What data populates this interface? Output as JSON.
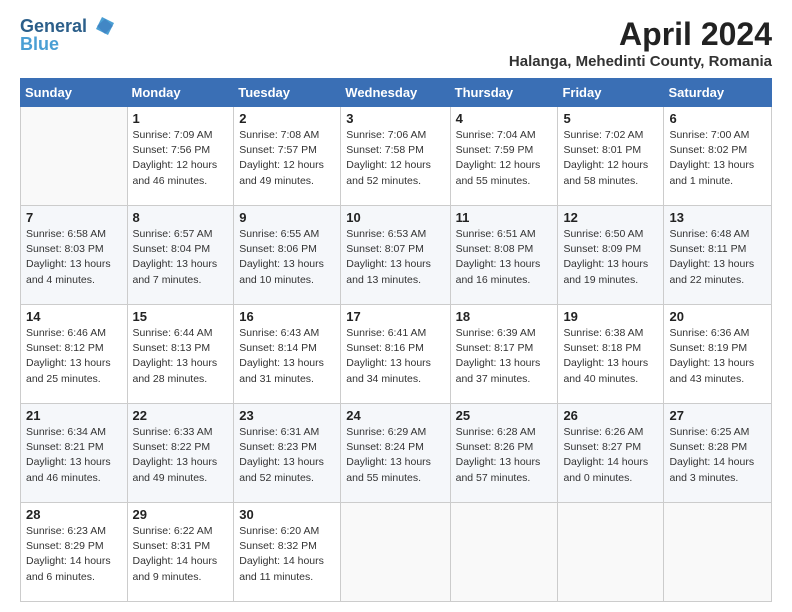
{
  "header": {
    "logo_line1": "General",
    "logo_line2": "Blue",
    "month": "April 2024",
    "location": "Halanga, Mehedinti County, Romania"
  },
  "days_of_week": [
    "Sunday",
    "Monday",
    "Tuesday",
    "Wednesday",
    "Thursday",
    "Friday",
    "Saturday"
  ],
  "weeks": [
    [
      {
        "day": "",
        "info": ""
      },
      {
        "day": "1",
        "info": "Sunrise: 7:09 AM\nSunset: 7:56 PM\nDaylight: 12 hours\nand 46 minutes."
      },
      {
        "day": "2",
        "info": "Sunrise: 7:08 AM\nSunset: 7:57 PM\nDaylight: 12 hours\nand 49 minutes."
      },
      {
        "day": "3",
        "info": "Sunrise: 7:06 AM\nSunset: 7:58 PM\nDaylight: 12 hours\nand 52 minutes."
      },
      {
        "day": "4",
        "info": "Sunrise: 7:04 AM\nSunset: 7:59 PM\nDaylight: 12 hours\nand 55 minutes."
      },
      {
        "day": "5",
        "info": "Sunrise: 7:02 AM\nSunset: 8:01 PM\nDaylight: 12 hours\nand 58 minutes."
      },
      {
        "day": "6",
        "info": "Sunrise: 7:00 AM\nSunset: 8:02 PM\nDaylight: 13 hours\nand 1 minute."
      }
    ],
    [
      {
        "day": "7",
        "info": "Sunrise: 6:58 AM\nSunset: 8:03 PM\nDaylight: 13 hours\nand 4 minutes."
      },
      {
        "day": "8",
        "info": "Sunrise: 6:57 AM\nSunset: 8:04 PM\nDaylight: 13 hours\nand 7 minutes."
      },
      {
        "day": "9",
        "info": "Sunrise: 6:55 AM\nSunset: 8:06 PM\nDaylight: 13 hours\nand 10 minutes."
      },
      {
        "day": "10",
        "info": "Sunrise: 6:53 AM\nSunset: 8:07 PM\nDaylight: 13 hours\nand 13 minutes."
      },
      {
        "day": "11",
        "info": "Sunrise: 6:51 AM\nSunset: 8:08 PM\nDaylight: 13 hours\nand 16 minutes."
      },
      {
        "day": "12",
        "info": "Sunrise: 6:50 AM\nSunset: 8:09 PM\nDaylight: 13 hours\nand 19 minutes."
      },
      {
        "day": "13",
        "info": "Sunrise: 6:48 AM\nSunset: 8:11 PM\nDaylight: 13 hours\nand 22 minutes."
      }
    ],
    [
      {
        "day": "14",
        "info": "Sunrise: 6:46 AM\nSunset: 8:12 PM\nDaylight: 13 hours\nand 25 minutes."
      },
      {
        "day": "15",
        "info": "Sunrise: 6:44 AM\nSunset: 8:13 PM\nDaylight: 13 hours\nand 28 minutes."
      },
      {
        "day": "16",
        "info": "Sunrise: 6:43 AM\nSunset: 8:14 PM\nDaylight: 13 hours\nand 31 minutes."
      },
      {
        "day": "17",
        "info": "Sunrise: 6:41 AM\nSunset: 8:16 PM\nDaylight: 13 hours\nand 34 minutes."
      },
      {
        "day": "18",
        "info": "Sunrise: 6:39 AM\nSunset: 8:17 PM\nDaylight: 13 hours\nand 37 minutes."
      },
      {
        "day": "19",
        "info": "Sunrise: 6:38 AM\nSunset: 8:18 PM\nDaylight: 13 hours\nand 40 minutes."
      },
      {
        "day": "20",
        "info": "Sunrise: 6:36 AM\nSunset: 8:19 PM\nDaylight: 13 hours\nand 43 minutes."
      }
    ],
    [
      {
        "day": "21",
        "info": "Sunrise: 6:34 AM\nSunset: 8:21 PM\nDaylight: 13 hours\nand 46 minutes."
      },
      {
        "day": "22",
        "info": "Sunrise: 6:33 AM\nSunset: 8:22 PM\nDaylight: 13 hours\nand 49 minutes."
      },
      {
        "day": "23",
        "info": "Sunrise: 6:31 AM\nSunset: 8:23 PM\nDaylight: 13 hours\nand 52 minutes."
      },
      {
        "day": "24",
        "info": "Sunrise: 6:29 AM\nSunset: 8:24 PM\nDaylight: 13 hours\nand 55 minutes."
      },
      {
        "day": "25",
        "info": "Sunrise: 6:28 AM\nSunset: 8:26 PM\nDaylight: 13 hours\nand 57 minutes."
      },
      {
        "day": "26",
        "info": "Sunrise: 6:26 AM\nSunset: 8:27 PM\nDaylight: 14 hours\nand 0 minutes."
      },
      {
        "day": "27",
        "info": "Sunrise: 6:25 AM\nSunset: 8:28 PM\nDaylight: 14 hours\nand 3 minutes."
      }
    ],
    [
      {
        "day": "28",
        "info": "Sunrise: 6:23 AM\nSunset: 8:29 PM\nDaylight: 14 hours\nand 6 minutes."
      },
      {
        "day": "29",
        "info": "Sunrise: 6:22 AM\nSunset: 8:31 PM\nDaylight: 14 hours\nand 9 minutes."
      },
      {
        "day": "30",
        "info": "Sunrise: 6:20 AM\nSunset: 8:32 PM\nDaylight: 14 hours\nand 11 minutes."
      },
      {
        "day": "",
        "info": ""
      },
      {
        "day": "",
        "info": ""
      },
      {
        "day": "",
        "info": ""
      },
      {
        "day": "",
        "info": ""
      }
    ]
  ]
}
